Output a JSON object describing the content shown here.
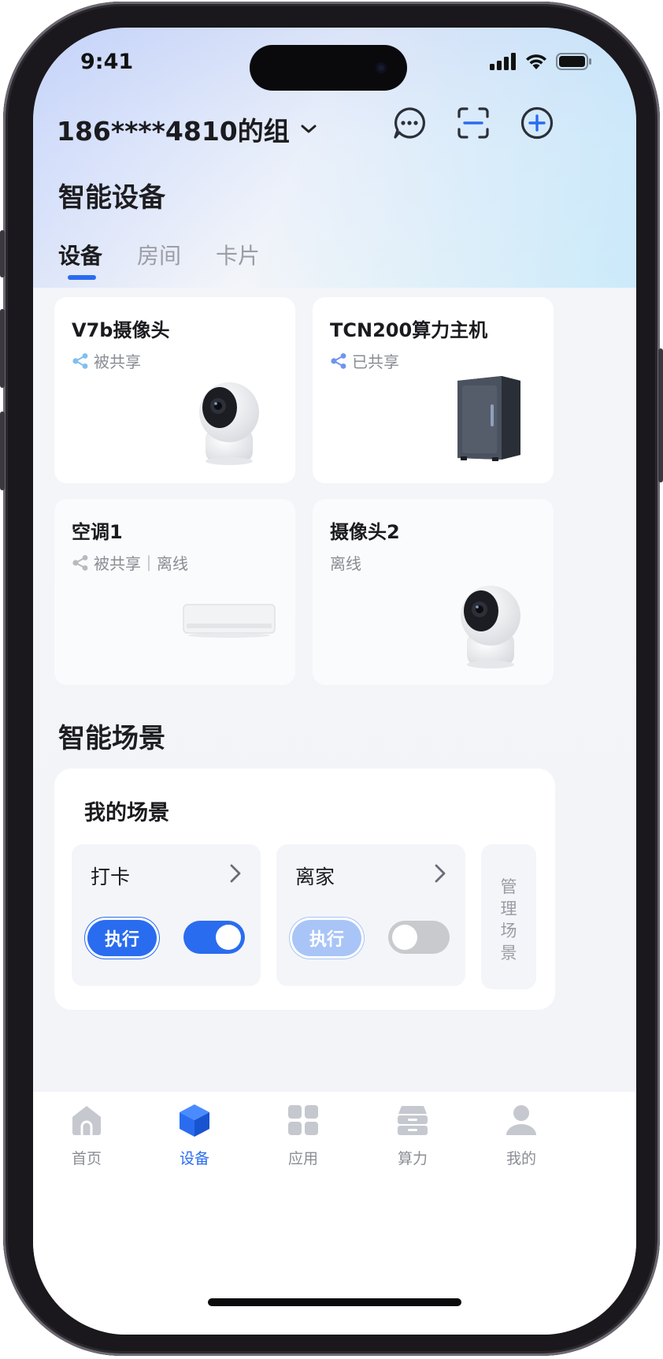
{
  "status": {
    "time": "9:41"
  },
  "header": {
    "group_name": "186****4810的组",
    "icons": [
      "chat-icon",
      "scan-icon",
      "add-icon"
    ]
  },
  "devices_section": {
    "title": "智能设备",
    "tabs": [
      "设备",
      "房间",
      "卡片"
    ],
    "active_tab": "设备",
    "cards": [
      {
        "name": "V7b摄像头",
        "status": "被共享",
        "icon": "share-icon",
        "image": "camera"
      },
      {
        "name": "TCN200算力主机",
        "status": "已共享",
        "icon": "share-icon",
        "image": "server"
      },
      {
        "name": "空调1",
        "status": "被共享｜离线",
        "icon": "share-icon",
        "image": "air-conditioner"
      },
      {
        "name": "摄像头2",
        "status": "离线",
        "image": "camera"
      }
    ]
  },
  "scenes_section": {
    "title": "智能场景",
    "panel_title": "我的场景",
    "scenes": [
      {
        "name": "打卡",
        "exec_label": "执行",
        "enabled": true
      },
      {
        "name": "离家",
        "exec_label": "执行",
        "enabled": false
      }
    ],
    "manage_label": "管理场景"
  },
  "bottom_nav": {
    "items": [
      {
        "label": "首页",
        "icon": "home-icon"
      },
      {
        "label": "设备",
        "icon": "device-cube-icon"
      },
      {
        "label": "应用",
        "icon": "apps-grid-icon"
      },
      {
        "label": "算力",
        "icon": "compute-icon"
      },
      {
        "label": "我的",
        "icon": "profile-icon"
      }
    ],
    "active": "设备"
  },
  "colors": {
    "accent": "#2a6cf0",
    "accent_disabled": "#a9c5f7",
    "muted": "#8a8c94"
  }
}
